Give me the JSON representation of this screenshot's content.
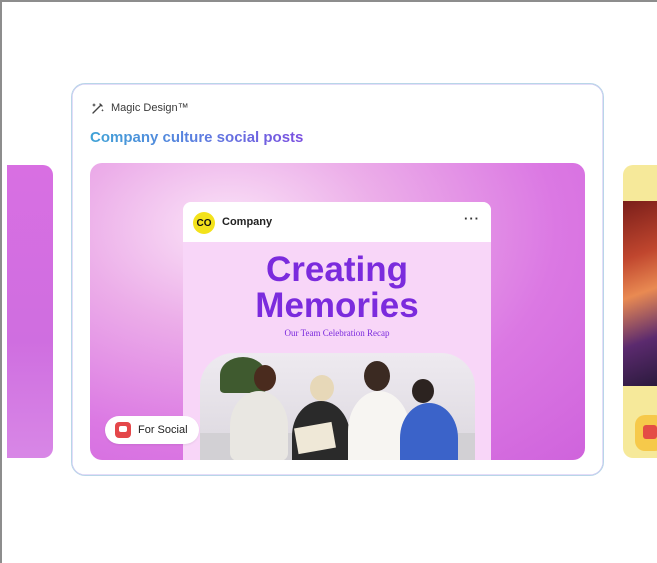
{
  "card": {
    "magic_label": "Magic Design™",
    "title": "Company culture social posts"
  },
  "post": {
    "avatar_text": "CO",
    "company": "Company",
    "menu": "···",
    "headline_line1": "Creating",
    "headline_line2": "Memories",
    "subline": "Our Team Celebration Recap"
  },
  "badge": {
    "label": "For Social"
  },
  "colors": {
    "accent_purple": "#7b2bdd",
    "hero_pink": "#d86fe2",
    "badge_red": "#e4474a",
    "title_gradient_start": "#3fa2d6",
    "title_gradient_end": "#7b4fe0"
  },
  "icons": {
    "magic": "magic-wand-icon",
    "badge": "heart-speech-icon",
    "menu": "more-horizontal-icon"
  }
}
